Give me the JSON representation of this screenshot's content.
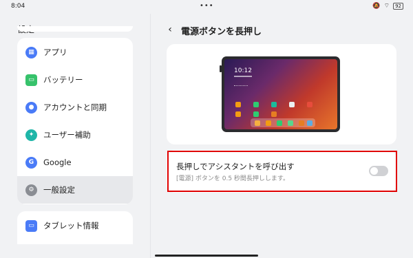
{
  "status_bar": {
    "time": "8:04",
    "center_dots": "•••",
    "battery": "92",
    "icons": [
      "mute-icon",
      "wifi-icon",
      "battery-icon"
    ]
  },
  "sidebar": {
    "title": "設定",
    "items": [
      {
        "label": "アプリ",
        "icon": "apps-icon",
        "color": "#4a7bf7"
      },
      {
        "label": "バッテリー",
        "icon": "battery-icon",
        "color": "#36c26b"
      },
      {
        "label": "アカウントと同期",
        "icon": "account-icon",
        "color": "#4a7bf7"
      },
      {
        "label": "ユーザー補助",
        "icon": "accessibility-icon",
        "color": "#1fb6a8"
      },
      {
        "label": "Google",
        "icon": "google-icon",
        "color": "#4a7bf7"
      },
      {
        "label": "一般設定",
        "icon": "gear-icon",
        "color": "#8a8d93",
        "selected": true
      }
    ],
    "bottom_item": {
      "label": "タブレット情報",
      "icon": "tablet-icon",
      "color": "#4a7bf7"
    }
  },
  "main": {
    "title": "電源ボタンを長押し",
    "preview": {
      "clock": "10:12"
    },
    "setting": {
      "title": "長押しでアシスタントを呼び出す",
      "subtitle": "[電源] ボタンを 0.5 秒間長押しします。",
      "enabled": false
    }
  },
  "colors": {
    "highlight": "#e00000",
    "accent": "#4a7bf7"
  }
}
